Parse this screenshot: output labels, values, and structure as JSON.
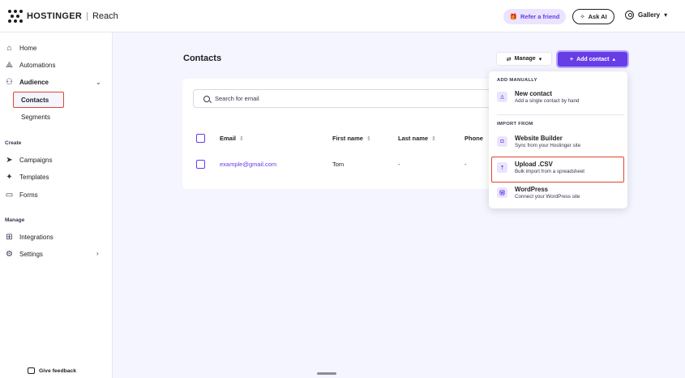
{
  "brand": {
    "name": "HOSTINGER",
    "separator": "|",
    "product": "Reach"
  },
  "header": {
    "refer_label": "Refer a friend",
    "ask_ai_label": "Ask AI",
    "workspace_label": "Gallery"
  },
  "sidebar": {
    "items": [
      {
        "label": "Home",
        "icon": "home-icon"
      },
      {
        "label": "Automations",
        "icon": "automations-icon"
      },
      {
        "label": "Audience",
        "icon": "audience-icon"
      }
    ],
    "audience_sub": [
      "Contacts",
      "Segments"
    ],
    "create_section": "Create",
    "create_items": [
      "Campaigns",
      "Templates",
      "Forms"
    ],
    "manage_section": "Manage",
    "manage_items": [
      "Integrations",
      "Settings"
    ],
    "feedback_label": "Give feedback"
  },
  "main": {
    "title": "Contacts",
    "manage_label": "Manage",
    "add_contact_label": "Add contact",
    "search_placeholder": "Search for email",
    "columns": [
      "Email",
      "First name",
      "Last name",
      "Phone"
    ],
    "rows": [
      {
        "email": "example@gmail.com",
        "first_name": "Tom",
        "last_name": "-",
        "phone": "-"
      }
    ]
  },
  "dropdown": {
    "section_manual": "ADD MANUALLY",
    "section_import": "IMPORT FROM",
    "items": [
      {
        "title": "New contact",
        "desc": "Add a single contact by hand"
      },
      {
        "title": "Website Builder",
        "desc": "Sync from your Hostinger site"
      },
      {
        "title": "Upload .CSV",
        "desc": "Bulk import from a spreadsheet"
      },
      {
        "title": "WordPress",
        "desc": "Connect your WordPress site"
      }
    ]
  },
  "colors": {
    "accent": "#673de6",
    "highlight": "#e0452f",
    "background": "#f4f5ff"
  }
}
